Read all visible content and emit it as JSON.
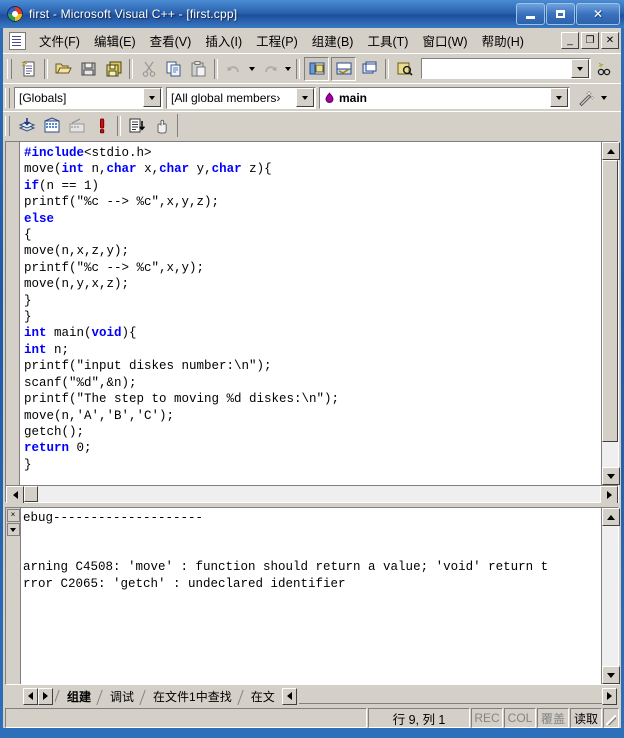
{
  "window": {
    "title": "first - Microsoft Visual C++ - [first.cpp]",
    "app_icon": "vcpp-palette-icon",
    "buttons": {
      "minimize": "minimize-button",
      "maximize": "maximize-button",
      "close": "✕"
    }
  },
  "menubar": {
    "doc_icon": "document-icon",
    "items": [
      {
        "label": "文件(F)"
      },
      {
        "label": "编辑(E)"
      },
      {
        "label": "查看(V)"
      },
      {
        "label": "插入(I)"
      },
      {
        "label": "工程(P)"
      },
      {
        "label": "组建(B)"
      },
      {
        "label": "工具(T)"
      },
      {
        "label": "窗口(W)"
      },
      {
        "label": "帮助(H)"
      }
    ],
    "mdi": {
      "minimize": "_",
      "restore": "❐",
      "close": "✕"
    }
  },
  "standard_toolbar": {
    "buttons": [
      {
        "name": "new-text-file-icon"
      },
      {
        "name": "open-folder-icon"
      },
      {
        "name": "save-icon"
      },
      {
        "name": "save-all-icon"
      },
      {
        "name": "cut-scissors-icon"
      },
      {
        "name": "copy-icon"
      },
      {
        "name": "paste-icon"
      },
      {
        "name": "undo-icon"
      },
      {
        "name": "redo-icon"
      },
      {
        "name": "workspace-window-icon"
      },
      {
        "name": "output-window-icon"
      },
      {
        "name": "window-list-icon"
      },
      {
        "name": "find-in-files-icon"
      }
    ],
    "find_box": {
      "value": "",
      "placeholder": ""
    },
    "find_button": "find-binoculars-icon"
  },
  "wizard_bar": {
    "globals_combo": {
      "value": "[Globals]"
    },
    "members_combo": {
      "value": "[All global members›"
    },
    "symbol_combo": {
      "value": "main",
      "icon": "class-member-icon"
    },
    "wizard_button": "magic-wand-icon"
  },
  "build_toolbar": {
    "buttons": [
      {
        "name": "compile-icon"
      },
      {
        "name": "build-icon"
      },
      {
        "name": "stop-build-icon"
      },
      {
        "name": "execute-program-icon"
      },
      {
        "name": "go-debug-icon"
      },
      {
        "name": "insert-remove-breakpoint-icon"
      }
    ]
  },
  "editor": {
    "filename": "first.cpp",
    "lines": [
      [
        {
          "t": "#include",
          "c": "pp"
        },
        {
          "t": "<stdio.h>",
          "c": ""
        }
      ],
      [
        {
          "t": "move(",
          "c": ""
        },
        {
          "t": "int",
          "c": "kw"
        },
        {
          "t": " n,",
          "c": ""
        },
        {
          "t": "char",
          "c": "kw"
        },
        {
          "t": " x,",
          "c": ""
        },
        {
          "t": "char",
          "c": "kw"
        },
        {
          "t": " y,",
          "c": ""
        },
        {
          "t": "char",
          "c": "kw"
        },
        {
          "t": " z){",
          "c": ""
        }
      ],
      [
        {
          "t": "if",
          "c": "kw"
        },
        {
          "t": "(n == 1)",
          "c": ""
        }
      ],
      [
        {
          "t": "printf(\"%c --> %c\",x,y,z);",
          "c": ""
        }
      ],
      [
        {
          "t": "else",
          "c": "kw"
        }
      ],
      [
        {
          "t": "{",
          "c": ""
        }
      ],
      [
        {
          "t": "move(n,x,z,y);",
          "c": ""
        }
      ],
      [
        {
          "t": "printf(\"%c --> %c\",x,y);",
          "c": ""
        }
      ],
      [
        {
          "t": "move(n,y,x,z);",
          "c": ""
        }
      ],
      [
        {
          "t": "}",
          "c": ""
        }
      ],
      [
        {
          "t": "}",
          "c": ""
        }
      ],
      [
        {
          "t": "int",
          "c": "kw"
        },
        {
          "t": " main(",
          "c": ""
        },
        {
          "t": "void",
          "c": "kw"
        },
        {
          "t": "){",
          "c": ""
        }
      ],
      [
        {
          "t": "int",
          "c": "kw"
        },
        {
          "t": " n;",
          "c": ""
        }
      ],
      [
        {
          "t": "printf(\"input diskes number:\\n\");",
          "c": ""
        }
      ],
      [
        {
          "t": "scanf(\"%d\",&n);",
          "c": ""
        }
      ],
      [
        {
          "t": "printf(\"The step to moving %d diskes:\\n\");",
          "c": ""
        }
      ],
      [
        {
          "t": "move(n,'A','B','C');",
          "c": ""
        }
      ],
      [
        {
          "t": "getch();",
          "c": ""
        }
      ],
      [
        {
          "t": "return",
          "c": "kw"
        },
        {
          "t": " 0;",
          "c": ""
        }
      ],
      [
        {
          "t": "}",
          "c": ""
        }
      ]
    ]
  },
  "output": {
    "close_icon": "×",
    "pin_icon": "dropdown-icon",
    "lines": [
      "ebug--------------------",
      "",
      "",
      "arning C4508: 'move' : function should return a value; 'void' return t",
      "rror C2065: 'getch' : undeclared identifier"
    ]
  },
  "tabbar": {
    "nav": {
      "prev": "◀",
      "next": "▶"
    },
    "tabs": [
      {
        "label": "组建",
        "active": true
      },
      {
        "label": "调试",
        "active": false
      },
      {
        "label": "在文件1中查找",
        "active": false
      },
      {
        "label": "在文",
        "active": false
      }
    ],
    "end_button": "◀",
    "scroll_right": "▶"
  },
  "statusbar": {
    "message": "",
    "position": "行 9, 列 1",
    "indicators": [
      {
        "label": "REC",
        "dim": true
      },
      {
        "label": "COL",
        "dim": true
      },
      {
        "label": "覆盖",
        "dim": true
      },
      {
        "label": "读取",
        "dim": false
      }
    ]
  },
  "colors": {
    "keyword": "#0000ff",
    "titlebar": "#2b63ae",
    "chrome": "#d4d0c8"
  }
}
